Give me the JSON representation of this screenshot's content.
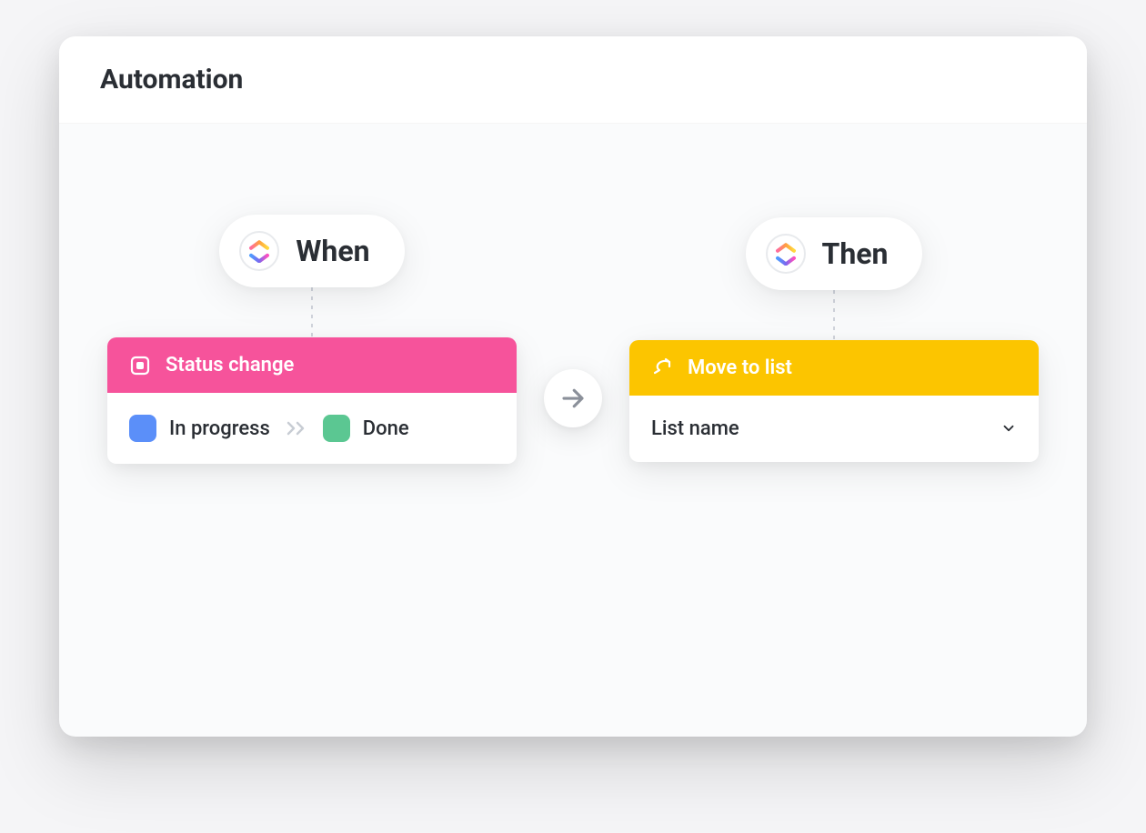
{
  "header": {
    "title": "Automation"
  },
  "when": {
    "pill_label": "When",
    "trigger_label": "Status change",
    "from_status": "In progress",
    "to_status": "Done",
    "colors": {
      "header": "#f6539b",
      "from_swatch": "#5b8ff9",
      "to_swatch": "#5bc792"
    }
  },
  "then": {
    "pill_label": "Then",
    "action_label": "Move to list",
    "list_placeholder": "List name",
    "colors": {
      "header": "#fcc500"
    }
  }
}
